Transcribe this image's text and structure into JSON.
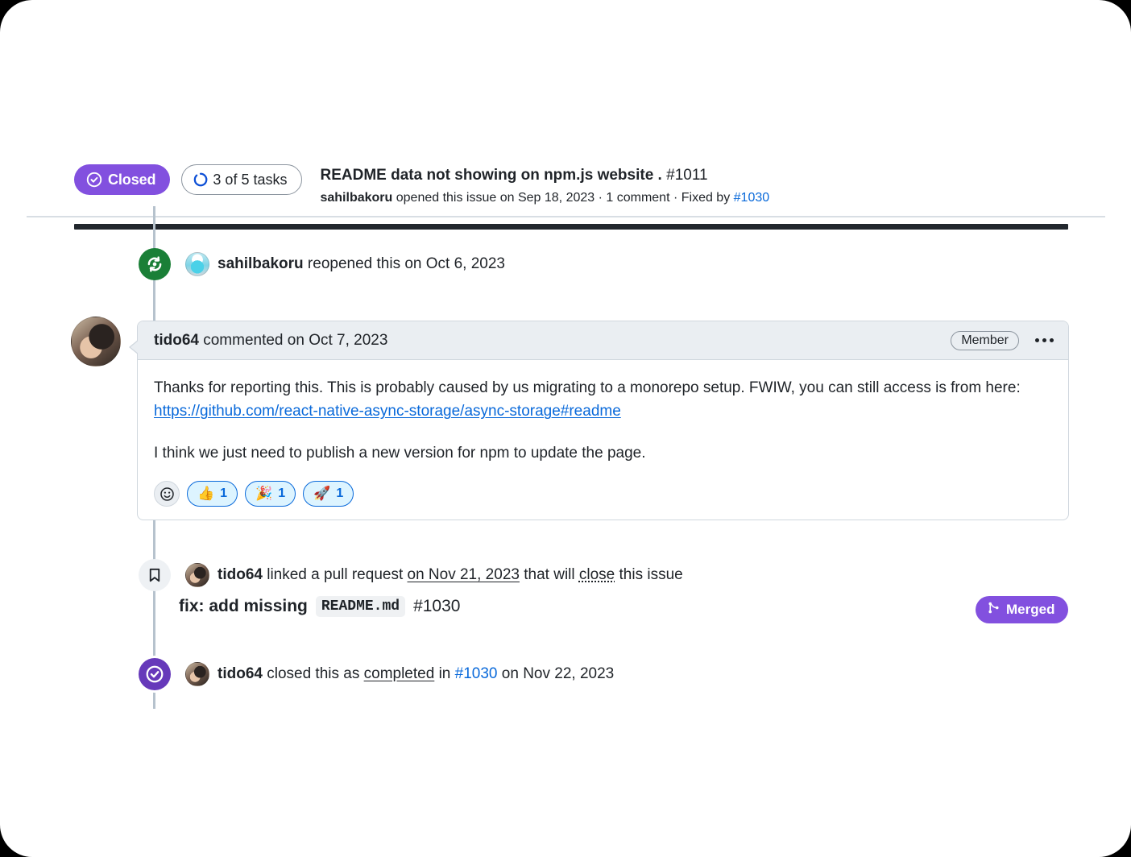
{
  "header": {
    "state_badge": {
      "label": "Closed",
      "icon": "issue-closed-icon",
      "color": "#8250df"
    },
    "tasks_badge": {
      "label": "3 of 5 tasks",
      "icon": "tasks-progress-icon"
    },
    "title": "README data not showing on npm.js website .",
    "issue_number": "#1011",
    "sub_author": "sahilbakoru",
    "sub_text": " opened this issue on Sep 18, 2023 · 1 comment · Fixed by ",
    "sub_link": "#1030"
  },
  "timeline": {
    "reopened": {
      "icon": "reopened-icon",
      "avatar": "sahilbakoru-avatar",
      "author": "sahilbakoru",
      "text": " reopened this on Oct 6, 2023"
    },
    "comment": {
      "avatar": "tido64-avatar",
      "author": "tido64",
      "header_text": " commented on Oct 7, 2023",
      "role_badge": "Member",
      "menu_icon": "kebab-menu-icon",
      "paragraph_1_pre": "Thanks for reporting this. This is probably caused by us migrating to a monorepo setup. FWIW, you can still access is from here: ",
      "paragraph_1_link": "https://github.com/react-native-async-storage/async-storage#readme",
      "paragraph_2": "I think we just need to publish a new version for npm to update the page.",
      "reactions": [
        {
          "emoji": "👍",
          "name": "thumbs-up-reaction",
          "count": "1"
        },
        {
          "emoji": "🎉",
          "name": "hooray-reaction",
          "count": "1"
        },
        {
          "emoji": "🚀",
          "name": "rocket-reaction",
          "count": "1"
        }
      ],
      "add_reaction_icon": "add-reaction-smiley-icon"
    },
    "linked_pr": {
      "icon": "bookmark-icon",
      "avatar": "tido64-avatar",
      "author": "tido64",
      "text_1": " linked a pull request ",
      "date": "on Nov 21, 2023",
      "text_2": " that will ",
      "action": "close",
      "text_3": " this issue",
      "pr_title_pre": "fix: add missing",
      "pr_title_code": "README.md",
      "pr_number": "#1030",
      "merged_label": "Merged",
      "merged_icon": "git-merge-icon"
    },
    "closed_event": {
      "icon": "closed-completed-icon",
      "avatar": "tido64-avatar",
      "author": "tido64",
      "text_1": " closed this as ",
      "reason": "completed",
      "text_2": " in ",
      "pr_link": "#1030",
      "text_3": " on Nov 22, 2023"
    }
  }
}
